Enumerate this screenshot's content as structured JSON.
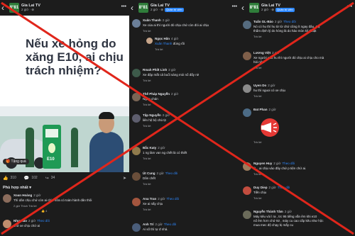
{
  "colors": {
    "accent": "#2d88ff",
    "cross": "#e0261b",
    "panel_bg": "#1c1c1c",
    "logo_green": "#2f7d3a"
  },
  "page": {
    "logo_text": "8°81",
    "name": "Gia Lai TV",
    "meta": "2 giờ · ⊕",
    "admin_badge": "Quản trị viên",
    "back_icon": "back-arrow-icon",
    "more_icon": "more-dots-icon"
  },
  "post": {
    "headline": "Nếu xe hỏng do xăng E10, ai chịu trách nhiệm?",
    "pump_label": "E10",
    "gift_label": "Tặng quà",
    "reaction_count": "310",
    "comment_count": "102",
    "share_count": "34",
    "sort_label": "Phù hợp nhất"
  },
  "panel1_comments": [
    {
      "name": "Xoan Hoàng",
      "time": "2 giờ",
      "text": "Thì dân chịu chứ còn ai chịu nữa có toàn hành dân thôi",
      "actions": "2 giờ  Thích  Trả lời",
      "likes": "4"
    },
    {
      "name": "Như Hào",
      "time": "2 giờ",
      "follow": "Theo dõi",
      "text": "chứ xe chịu chứ ai"
    }
  ],
  "panel2_comments": [
    {
      "name": "Xuân Thanh",
      "time": "2 giờ",
      "text": "Xe của ai thì người đó chịu chứ còn đòi ai chịu",
      "reply": "Trả lời"
    },
    {
      "name": "Ngọc Hân",
      "time": "4 giờ",
      "mention": "Xuân Thanh",
      "text": " đúng rồi",
      "reply": "Trả lời"
    },
    {
      "name": "Rmah Philt Linh",
      "time": "2 giờ",
      "text": "Xe đập mất cả buổi sáng mòi nổ đẩy nè",
      "reply": "Trả lời"
    },
    {
      "name": "Thế Pháp Nguyễn",
      "time": "2 giờ",
      "text": "Ngán chán",
      "reply": "Trả lời"
    },
    {
      "name": "Tập Nguyễn",
      "time": "2 giờ",
      "text": "liên hệ bộ chủ tịt",
      "reply": "Trả lời"
    },
    {
      "name": "Bắc Katy",
      "time": "2 giờ",
      "text": "1 ng làm van ng chết là có thiết",
      "reply": "Trả lời"
    },
    {
      "name": "Út Cung",
      "time": "2 giờ",
      "follow": "Theo dõi",
      "text": "Dân chết",
      "reply": "Trả lời"
    },
    {
      "name": "Ana Tran",
      "time": "2 giờ",
      "follow": "Theo dõi",
      "text": "Xe ai nấy chịu",
      "reply": "Trả lời"
    },
    {
      "name": "Anh Trí",
      "time": "2 giờ",
      "follow": "Theo dõi",
      "text": "Ai số thì tự đ nhá."
    }
  ],
  "panel3_comments": [
    {
      "name": "Tuấn GL-Báo",
      "time": "2 giờ",
      "follow": "Theo dõi",
      "lines": [
        "Nó có hu thì hu từ từ chứ cũng ít ngay đâu. Hạ",
        "thẩm định lý do hỏng là do hào mòn kỹ thuật"
      ]
    },
    {
      "name": "Lương Việt",
      "time": "2 giờ",
      "lines": [
        "Xe người nào hu thì người đó chịu ai chịu cho mà",
        "hỏi nữa"
      ]
    },
    {
      "name": "Uyen Do",
      "time": "2 giờ",
      "lines": [
        "hu thì nguoi có xe chịu"
      ]
    },
    {
      "name": "Đat Phan",
      "time": "2 giờ",
      "lines": []
    },
    {
      "name": "Nguyen Huy",
      "time": "2 giờ",
      "follow": "Theo dõi",
      "lines": [
        "Ý... ai chịu vào đây chứ p tiện chứ ai."
      ]
    },
    {
      "name": "Duy Diep",
      "time": "2 giờ",
      "follow": "Theo dõi",
      "lines": [
        "Tiền chịu"
      ]
    },
    {
      "name": "Nguyễn Thành Tâm",
      "time": "2 giờ",
      "lines": [
        "Máy kêu vòi l ra , trc 95 tiếng vẫn êm khi e10",
        "nổ êm hơn chứ 92 , máy cu cao cấp kêu như hộc",
        "mua mec độ chạy bị mấy cu"
      ]
    }
  ],
  "reply_label": "Trả lời"
}
